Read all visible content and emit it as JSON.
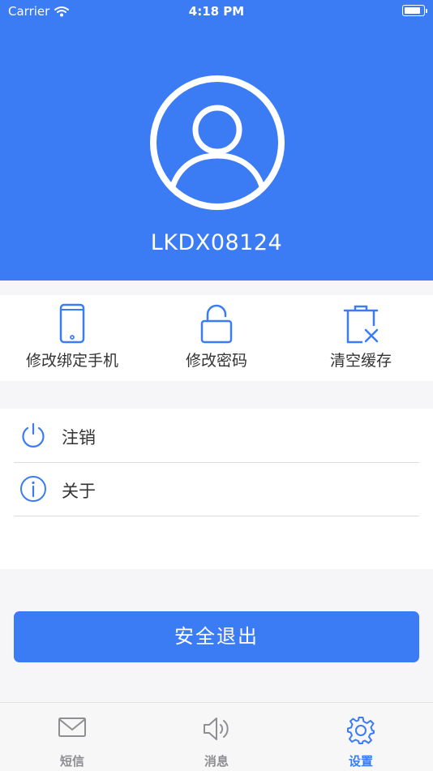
{
  "status_bar": {
    "carrier": "Carrier",
    "time": "4:18 PM"
  },
  "profile": {
    "username": "LKDX08124"
  },
  "quick_actions": [
    {
      "label": "修改绑定手机",
      "icon": "phone-icon"
    },
    {
      "label": "修改密码",
      "icon": "lock-icon"
    },
    {
      "label": "清空缓存",
      "icon": "trash-icon"
    }
  ],
  "menu": [
    {
      "label": "注销",
      "icon": "power-icon"
    },
    {
      "label": "关于",
      "icon": "info-icon"
    }
  ],
  "logout_button": "安全退出",
  "tabs": [
    {
      "label": "短信",
      "icon": "mail-icon",
      "active": false
    },
    {
      "label": "消息",
      "icon": "speaker-icon",
      "active": false
    },
    {
      "label": "设置",
      "icon": "gear-icon",
      "active": true
    }
  ],
  "colors": {
    "primary": "#3b7cf5",
    "background": "#f6f6f8",
    "inactive": "#8e8e93"
  }
}
